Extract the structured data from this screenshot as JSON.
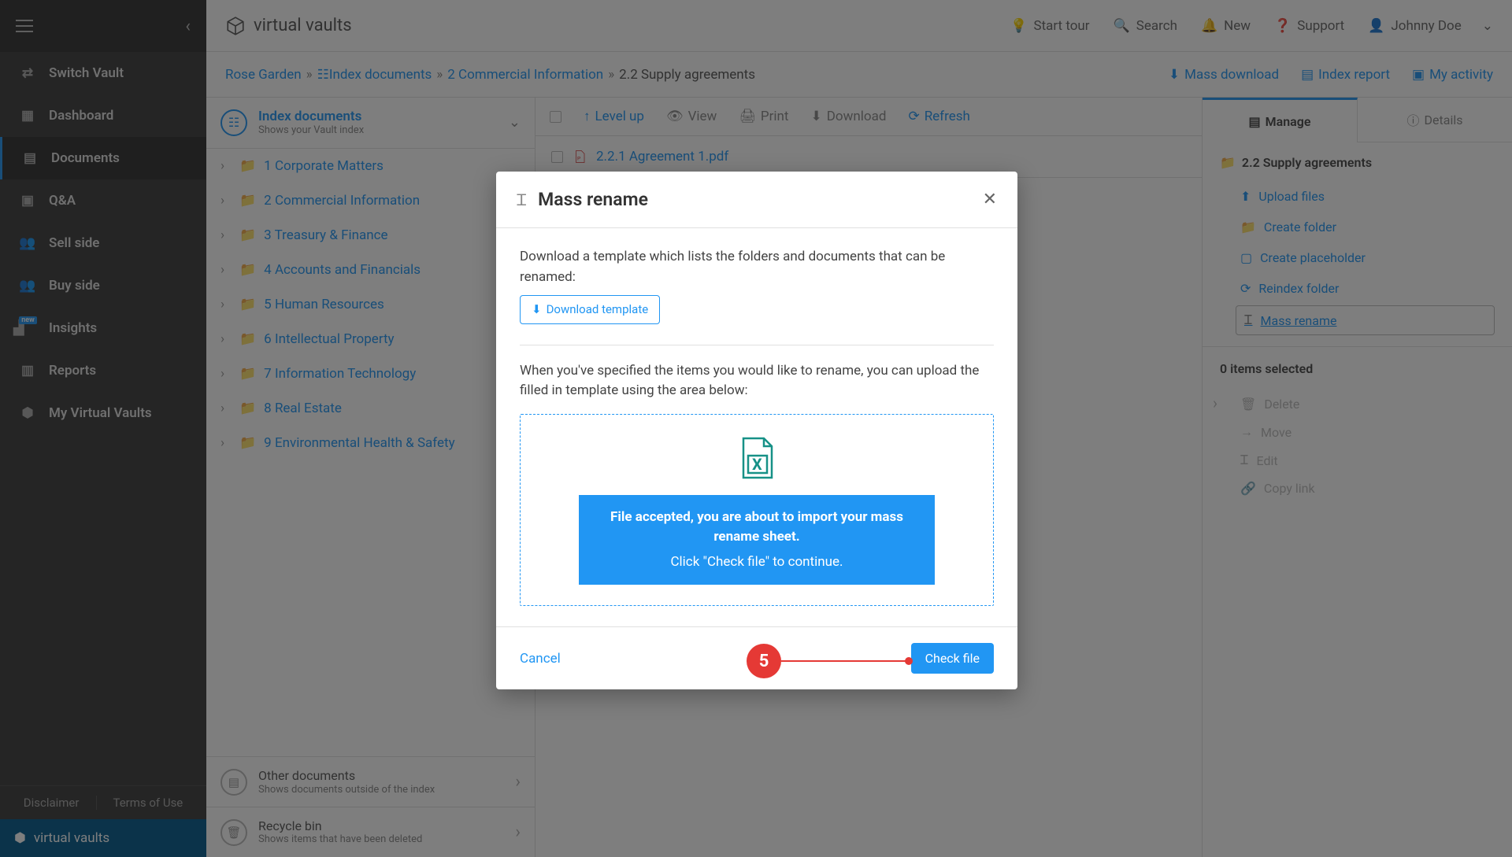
{
  "brand": "virtual vaults",
  "topbar": {
    "start_tour": "Start tour",
    "search": "Search",
    "new": "New",
    "support": "Support",
    "user": "Johnny Doe"
  },
  "sidebar": {
    "items": [
      {
        "icon": "⇄",
        "label": "Switch Vault"
      },
      {
        "icon": "▦",
        "label": "Dashboard"
      },
      {
        "icon": "▤",
        "label": "Documents"
      },
      {
        "icon": "💬",
        "label": "Q&A"
      },
      {
        "icon": "👥",
        "label": "Sell side"
      },
      {
        "icon": "👥",
        "label": "Buy side"
      },
      {
        "icon": "📊",
        "label": "Insights"
      },
      {
        "icon": "▥",
        "label": "Reports"
      },
      {
        "icon": "⬢",
        "label": "My Virtual Vaults"
      }
    ],
    "disclaimer": "Disclaimer",
    "terms": "Terms of Use",
    "footer_brand": "virtual vaults"
  },
  "breadcrumb": {
    "root": "Rose Garden",
    "parts": [
      "Index documents",
      "2 Commercial Information",
      "2.2 Supply agreements"
    ],
    "actions": {
      "mass_download": "Mass download",
      "index_report": "Index report",
      "my_activity": "My activity"
    }
  },
  "index": {
    "head": {
      "title": "Index documents",
      "sub": "Shows your Vault index"
    },
    "folders": [
      "1 Corporate Matters",
      "2 Commercial Information",
      "3 Treasury & Finance",
      "4 Accounts and Financials",
      "5 Human Resources",
      "6 Intellectual Property",
      "7 Information Technology",
      "8 Real Estate",
      "9 Environmental Health & Safety"
    ],
    "other": {
      "title": "Other documents",
      "sub": "Shows documents outside of the index"
    },
    "recycle": {
      "title": "Recycle bin",
      "sub": "Shows items that have been deleted"
    }
  },
  "file_toolbar": {
    "level_up": "Level up",
    "view": "View",
    "print": "Print",
    "download": "Download",
    "refresh": "Refresh"
  },
  "files": [
    {
      "name": "2.2.1 Agreement 1.pdf"
    }
  ],
  "right_panel": {
    "tabs": {
      "manage": "Manage",
      "details": "Details"
    },
    "section": "2.2 Supply agreements",
    "upload": "Upload files",
    "create_folder": "Create folder",
    "create_placeholder": "Create placeholder",
    "reindex": "Reindex folder",
    "mass_rename": "Mass rename",
    "items_selected": "0 items selected",
    "delete": "Delete",
    "move": "Move",
    "edit": "Edit",
    "copy_link": "Copy link"
  },
  "modal": {
    "title": "Mass rename",
    "desc1": "Download a template which lists the folders and documents that can be renamed:",
    "download_template": "Download template",
    "desc2": "When you've specified the items you would like to rename, you can upload the filled in template using the area below:",
    "accepted_line1": "File accepted, you are about to import your mass rename sheet.",
    "accepted_line2": "Click \"Check file\" to continue.",
    "cancel": "Cancel",
    "check_file": "Check file"
  },
  "annotation": {
    "step": "5"
  }
}
